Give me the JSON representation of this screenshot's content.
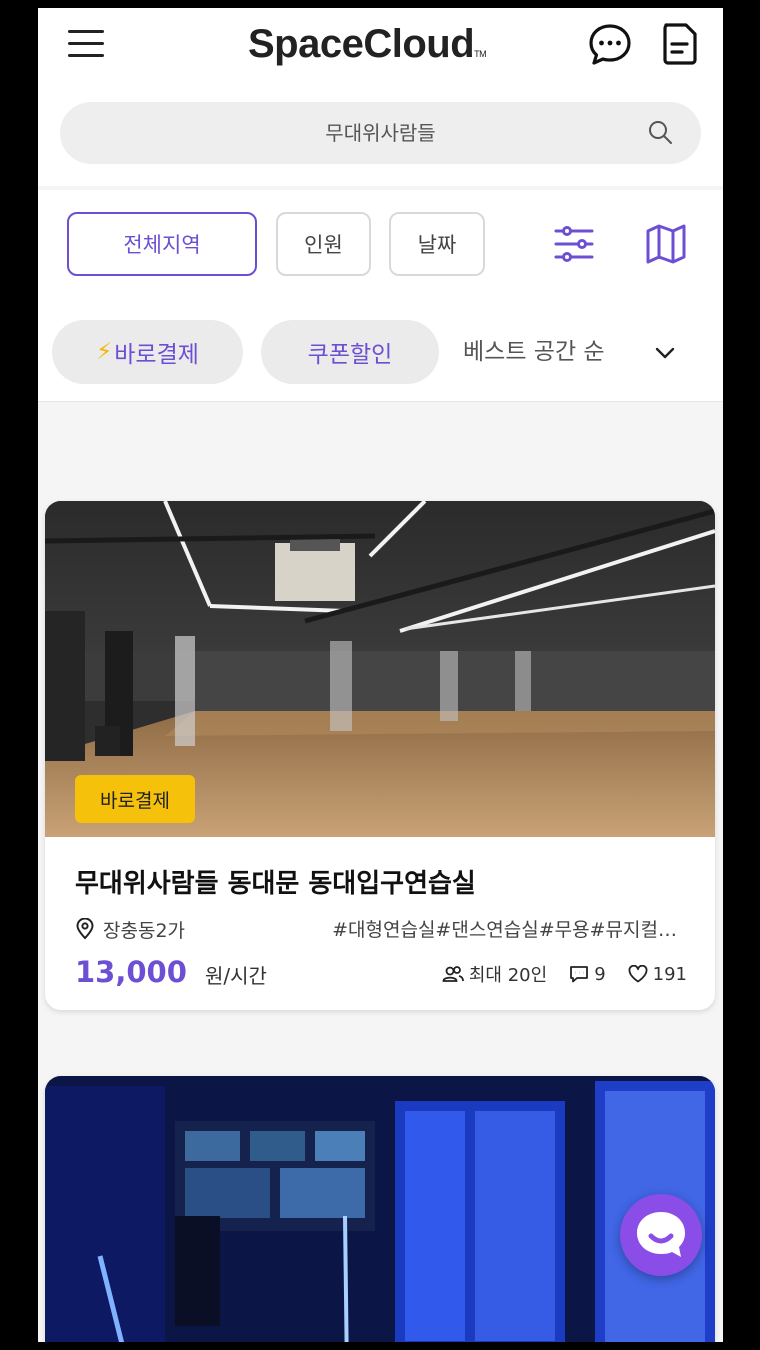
{
  "header": {
    "logo": "SpaceCloud",
    "logo_tm": "TM",
    "search_placeholder": "무대위사람들"
  },
  "filters": {
    "region": "전체지역",
    "people": "인원",
    "date": "날짜"
  },
  "chips": {
    "instant_pay": "바로결제",
    "coupon": "쿠폰할인",
    "sort": "베스트 공간 순"
  },
  "listings": [
    {
      "badge": "바로결제",
      "title": "무대위사람들 동대문 동대입구연습실",
      "location": "장충동2가",
      "tags": "#대형연습실#댄스연습실#무용#뮤지컬…",
      "price": "13,000",
      "price_unit": "원/시간",
      "capacity": "최대 20인",
      "reviews": "9",
      "likes": "191"
    }
  ],
  "colors": {
    "accent": "#6c4fd3",
    "badge": "#f5c10a",
    "fab": "#8a4de8"
  },
  "icons": [
    "menu-icon",
    "chat-icon",
    "document-icon",
    "search-icon",
    "filter-sliders-icon",
    "map-icon",
    "lightning-icon",
    "chevron-down-icon",
    "location-pin-icon",
    "people-icon",
    "comment-icon",
    "heart-icon",
    "chat-bot-icon"
  ]
}
